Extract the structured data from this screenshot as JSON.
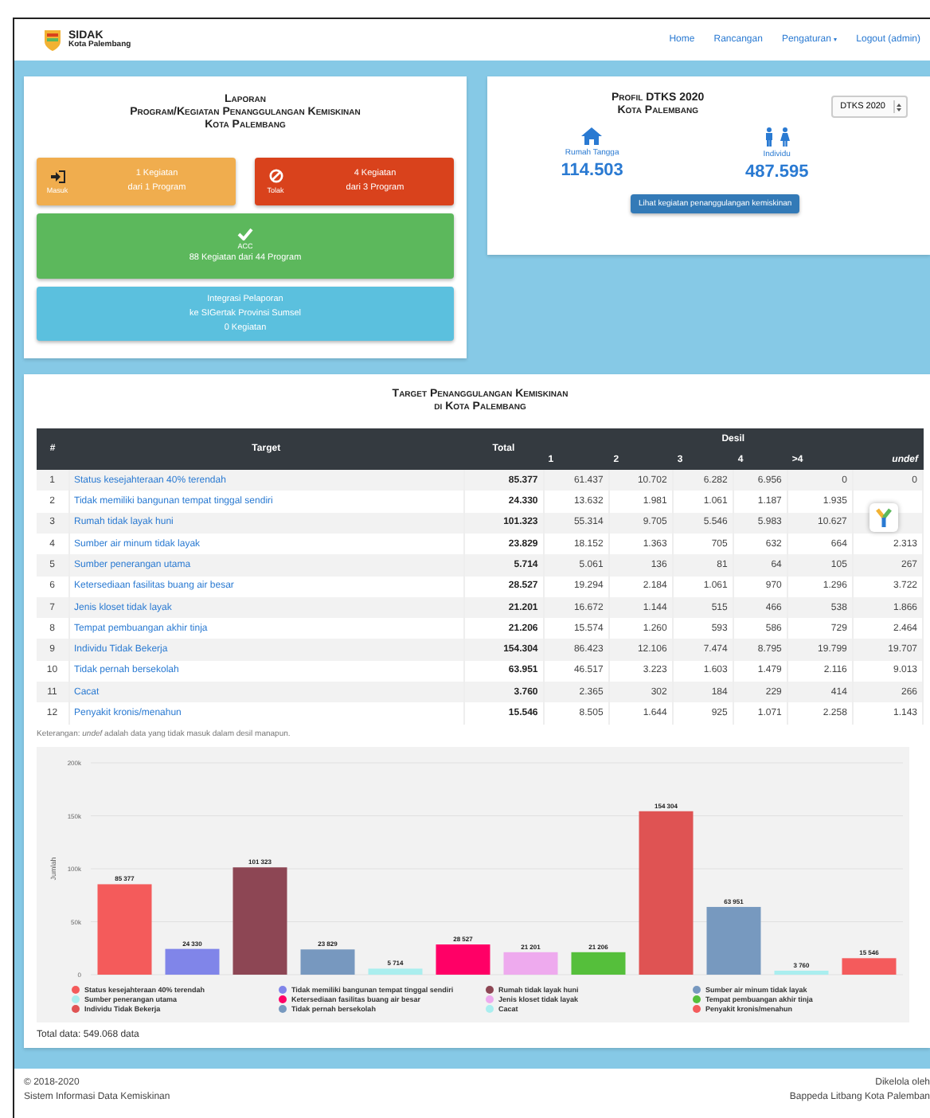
{
  "header": {
    "brand": "SIDAK",
    "subtitle": "Kota Palembang",
    "nav": [
      {
        "label": "Home"
      },
      {
        "label": "Rancangan"
      },
      {
        "label": "Pengaturan",
        "caret": "▾"
      },
      {
        "label": "Logout (admin)"
      }
    ]
  },
  "laporan": {
    "title": [
      "Laporan",
      "Program/Kegiatan Penanggulangan Kemiskinan",
      "Kota Palembang"
    ],
    "tiles": [
      {
        "kind": "masuk",
        "label": "Masuk",
        "lines": [
          "1 Kegiatan",
          "dari 1 Program"
        ]
      },
      {
        "kind": "tolak",
        "label": "Tolak",
        "lines": [
          "4 Kegiatan",
          "dari 3 Program"
        ]
      },
      {
        "kind": "acc",
        "label": "ACC",
        "lines": [
          "88 Kegiatan dari 44 Program"
        ]
      },
      {
        "kind": "integrasi",
        "lines": [
          "Integrasi Pelaporan",
          "ke SIGertak Provinsi Sumsel",
          "0 Kegiatan"
        ]
      }
    ]
  },
  "profil": {
    "title": [
      "Profil DTKS 2020",
      "Kota Palembang"
    ],
    "select": "DTKS 2020",
    "stats": [
      {
        "kind": "household",
        "label": "Rumah Tangga",
        "value": "114.503"
      },
      {
        "kind": "individual",
        "label": "Individu",
        "value": "487.595"
      }
    ],
    "button": "Lihat kegiatan penanggulangan kemiskinan"
  },
  "target": {
    "title": [
      "Target Penanggulangan Kemiskinan",
      "di Kota Palembang"
    ],
    "columns": {
      "number": "#",
      "target": "Target",
      "total": "Total",
      "group": "Desil",
      "desil": [
        "1",
        "2",
        "3",
        "4",
        ">4",
        "undef"
      ]
    },
    "rows": [
      {
        "no": "1",
        "target": "Status kesejahteraan 40% terendah",
        "total": "85.377",
        "desil": [
          "61.437",
          "10.702",
          "6.282",
          "6.956",
          "0",
          "0"
        ]
      },
      {
        "no": "2",
        "target": "Tidak memiliki bangunan tempat tinggal sendiri",
        "total": "24.330",
        "desil": [
          "13.632",
          "1.981",
          "1.061",
          "1.187",
          "1.935"
        ]
      },
      {
        "no": "3",
        "target": "Rumah tidak layak huni",
        "total": "101.323",
        "desil": [
          "55.314",
          "9.705",
          "5.546",
          "5.983",
          "10.627"
        ]
      },
      {
        "no": "4",
        "target": "Sumber air minum tidak layak",
        "total": "23.829",
        "desil": [
          "18.152",
          "1.363",
          "705",
          "632",
          "664",
          "2.313"
        ]
      },
      {
        "no": "5",
        "target": "Sumber penerangan utama",
        "total": "5.714",
        "desil": [
          "5.061",
          "136",
          "81",
          "64",
          "105",
          "267"
        ]
      },
      {
        "no": "6",
        "target": "Ketersediaan fasilitas buang air besar",
        "total": "28.527",
        "desil": [
          "19.294",
          "2.184",
          "1.061",
          "970",
          "1.296",
          "3.722"
        ]
      },
      {
        "no": "7",
        "target": "Jenis kloset tidak layak",
        "total": "21.201",
        "desil": [
          "16.672",
          "1.144",
          "515",
          "466",
          "538",
          "1.866"
        ]
      },
      {
        "no": "8",
        "target": "Tempat pembuangan akhir tinja",
        "total": "21.206",
        "desil": [
          "15.574",
          "1.260",
          "593",
          "586",
          "729",
          "2.464"
        ]
      },
      {
        "no": "9",
        "target": "Individu Tidak Bekerja",
        "total": "154.304",
        "desil": [
          "86.423",
          "12.106",
          "7.474",
          "8.795",
          "19.799",
          "19.707"
        ]
      },
      {
        "no": "10",
        "target": "Tidak pernah bersekolah",
        "total": "63.951",
        "desil": [
          "46.517",
          "3.223",
          "1.603",
          "1.479",
          "2.116",
          "9.013"
        ]
      },
      {
        "no": "11",
        "target": "Cacat",
        "total": "3.760",
        "desil": [
          "2.365",
          "302",
          "184",
          "229",
          "414",
          "266"
        ]
      },
      {
        "no": "12",
        "target": "Penyakit kronis/menahun",
        "total": "15.546",
        "desil": [
          "8.505",
          "1.644",
          "925",
          "1.071",
          "2.258",
          "1.143"
        ]
      }
    ],
    "note": "Keterangan: *undef* adalah data yang tidak masuk dalam desil manapun.",
    "chart_data": {
      "type": "bar",
      "ylabel": "Jumlah",
      "ylim": [
        0,
        200000
      ],
      "yticks": [
        0,
        {
          "value": 50000,
          "label": "50k"
        },
        {
          "value": 100000,
          "label": "100k"
        },
        {
          "value": 150000,
          "label": "150k"
        },
        {
          "value": 200000,
          "label": "200k"
        }
      ],
      "data_labels": true,
      "grid": true,
      "legend": true,
      "series": [
        {
          "name": "Status kesejahteraan 40% terendah",
          "color": "#f45b5b",
          "values": [
            85377
          ]
        },
        {
          "name": "Tidak memiliki bangunan tempat tinggal sendiri",
          "color": "#8085e9",
          "values": [
            24330
          ]
        },
        {
          "name": "Rumah tidak layak huni",
          "color": "#8d4654",
          "values": [
            101323
          ]
        },
        {
          "name": "Sumber air minum tidak layak",
          "color": "#7798bf",
          "values": [
            23829
          ]
        },
        {
          "name": "Sumber penerangan utama",
          "color": "#aaeeee",
          "values": [
            5714
          ]
        },
        {
          "name": "Ketersediaan fasilitas buang air besar",
          "color": "#ff0066",
          "values": [
            28527
          ]
        },
        {
          "name": "Jenis kloset tidak layak",
          "color": "#eeaaee",
          "values": [
            21201
          ]
        },
        {
          "name": "Tempat pembuangan akhir tinja",
          "color": "#55bf3b",
          "values": [
            21206
          ]
        },
        {
          "name": "Individu Tidak Bekerja",
          "color": "#df5353",
          "values": [
            154304
          ]
        },
        {
          "name": "Tidak pernah bersekolah",
          "color": "#7799bf",
          "values": [
            63951
          ]
        },
        {
          "name": "Cacat",
          "color": "#aaeeef",
          "values": [
            3760
          ]
        },
        {
          "name": "Penyakit kronis/menahun",
          "color": "#f45b5c",
          "values": [
            15546
          ]
        }
      ]
    },
    "total": "Total data: 549.068 data"
  },
  "footer": {
    "left": [
      "© 2018-2020",
      "Sistem Informasi Data Kemiskinan"
    ],
    "right": [
      "Dikelola oleh",
      "Bappeda Litbang Kota Palemban"
    ]
  }
}
